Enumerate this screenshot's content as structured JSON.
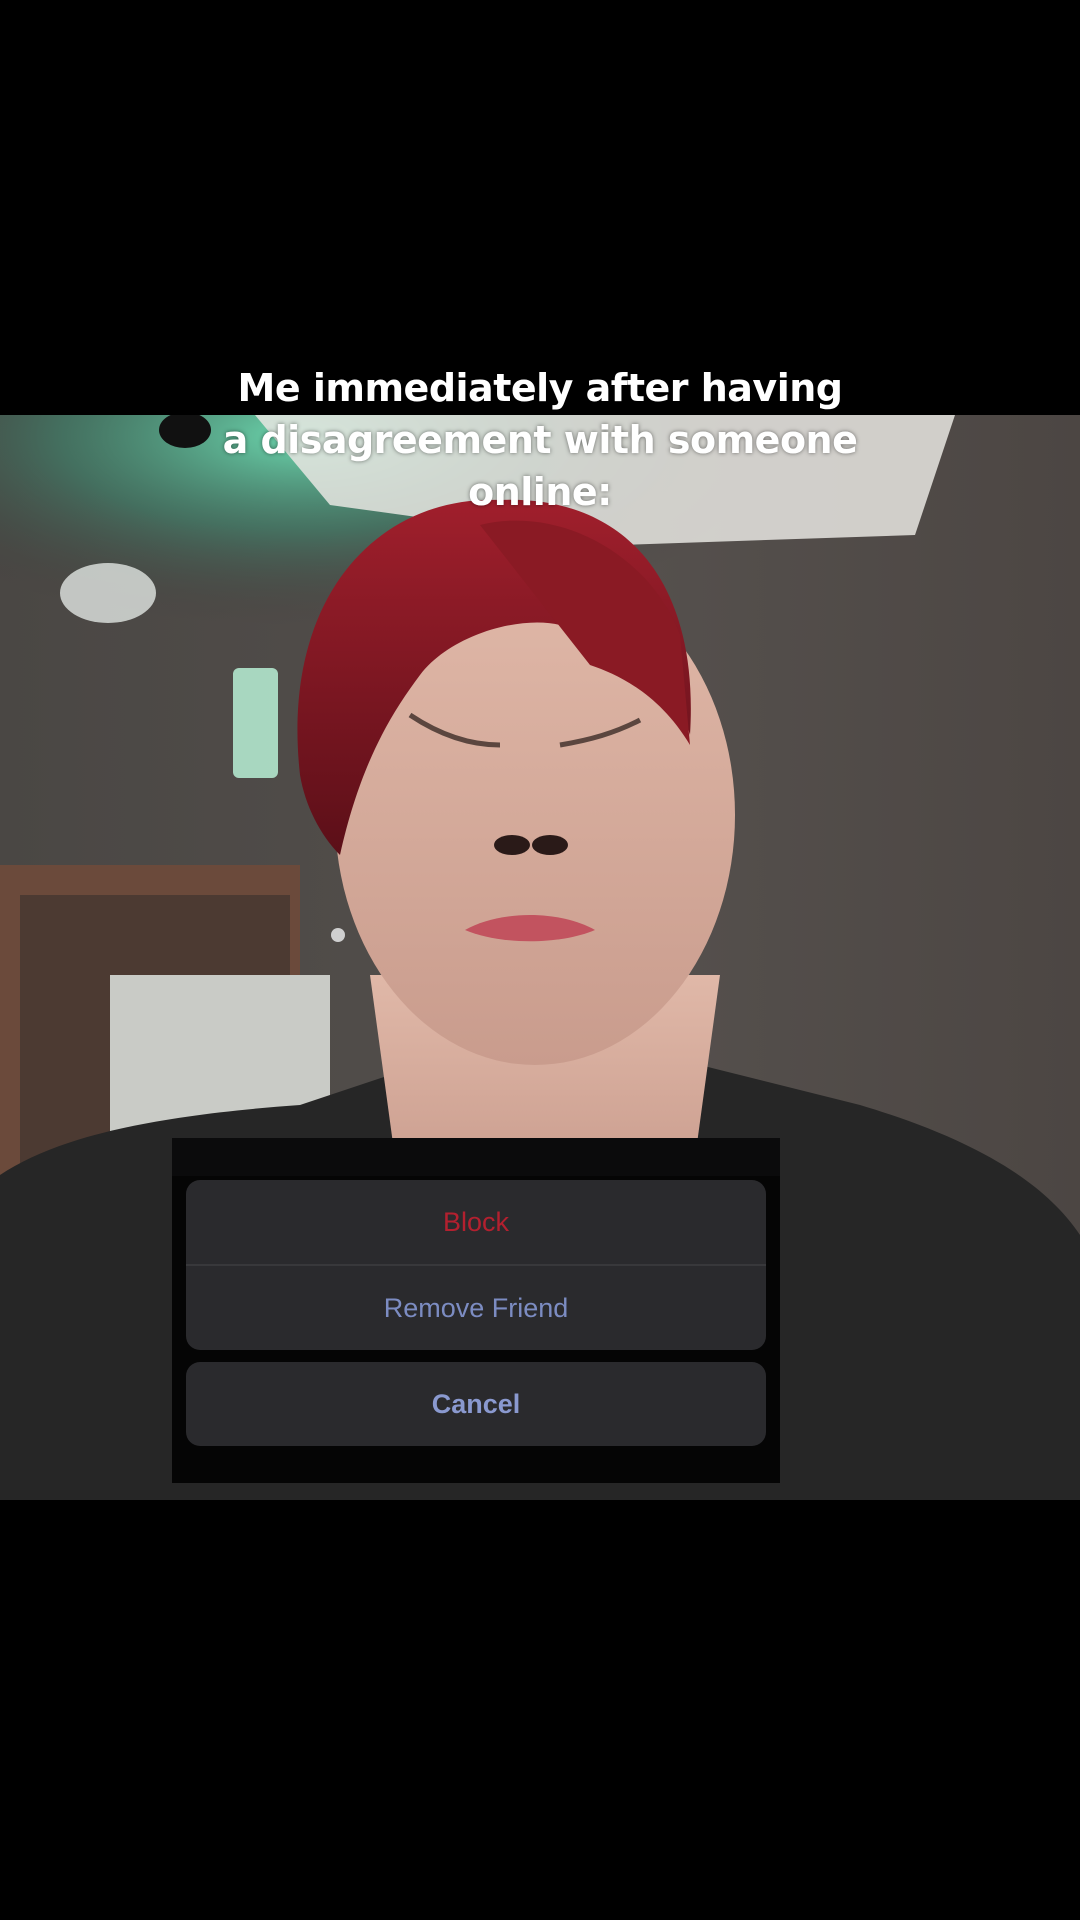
{
  "caption": {
    "line1": "Me immediately after having",
    "line2": "a disagreement with someone",
    "line3": "online:"
  },
  "action_sheet": {
    "block_label": "Block",
    "remove_friend_label": "Remove Friend",
    "cancel_label": "Cancel"
  },
  "colors": {
    "background": "#000000",
    "destructive": "#b3202f",
    "action": "#7c8cc2",
    "sheet": "#2a2a2d",
    "hair": "#8a1a24",
    "ceiling_light": "#5fd3a8"
  }
}
